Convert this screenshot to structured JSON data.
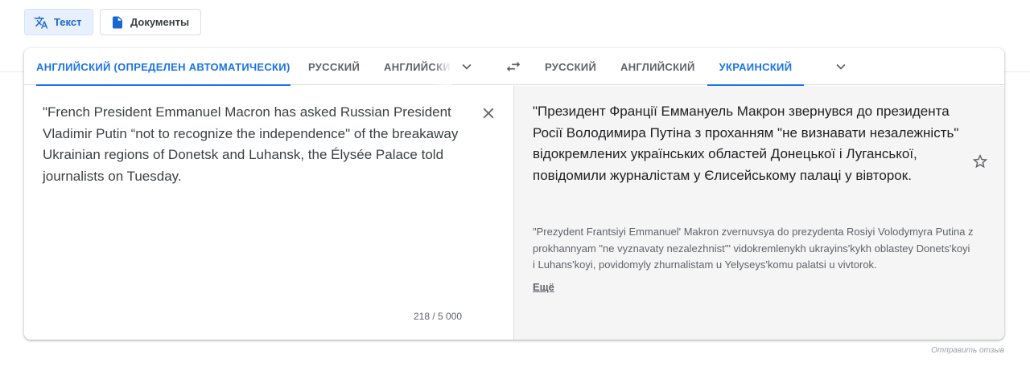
{
  "mode_buttons": {
    "text_label": "Текст",
    "documents_label": "Документы"
  },
  "source_tabs": [
    {
      "label": "АНГЛИЙСКИЙ (ОПРЕДЕЛЕН АВТОМАТИЧЕСКИ)",
      "active": true
    },
    {
      "label": "РУССКИЙ",
      "active": false
    },
    {
      "label": "АНГЛИЙСКИЙ",
      "active": false
    }
  ],
  "target_tabs": [
    {
      "label": "РУССКИЙ",
      "active": false
    },
    {
      "label": "АНГЛИЙСКИЙ",
      "active": false
    },
    {
      "label": "УКРАИНСКИЙ",
      "active": true
    }
  ],
  "source": {
    "text": "\"French President Emmanuel Macron has asked Russian President Vladimir Putin “not to recognize the independence\" of the breakaway Ukrainian regions of Donetsk and Luhansk, the Élysée Palace told journalists on Tuesday.",
    "char_count": "218 / 5 000"
  },
  "target": {
    "text": "\"Президент Франції Еммануель Макрон звернувся до президента Росії Володимира Путіна з проханням \"не визнавати незалежність\" відокремлених українських областей Донецької і Луганської, повідомили журналістам у Єлисейському палаці у вівторок.",
    "transliteration": "\"Prezydent Frantsiyi Emmanuel' Makron zvernuvsya do prezydenta Rosiyi Volodymyra Putina z prokhannyam \"ne vyznavaty nezalezhnist'\" vidokremlenykh ukrayins'kykh oblastey Donets'koyi i Luhans'koyi, povidomyly zhurnalistam u Yelyseys'komu palatsi u vivtorok.",
    "more_label": "Ещё"
  },
  "footer": {
    "feedback_label": "Отправить отзыв"
  },
  "colors": {
    "accent": "#1a73e8",
    "icon": "#5f6368",
    "target_bg": "#f5f5f5"
  }
}
